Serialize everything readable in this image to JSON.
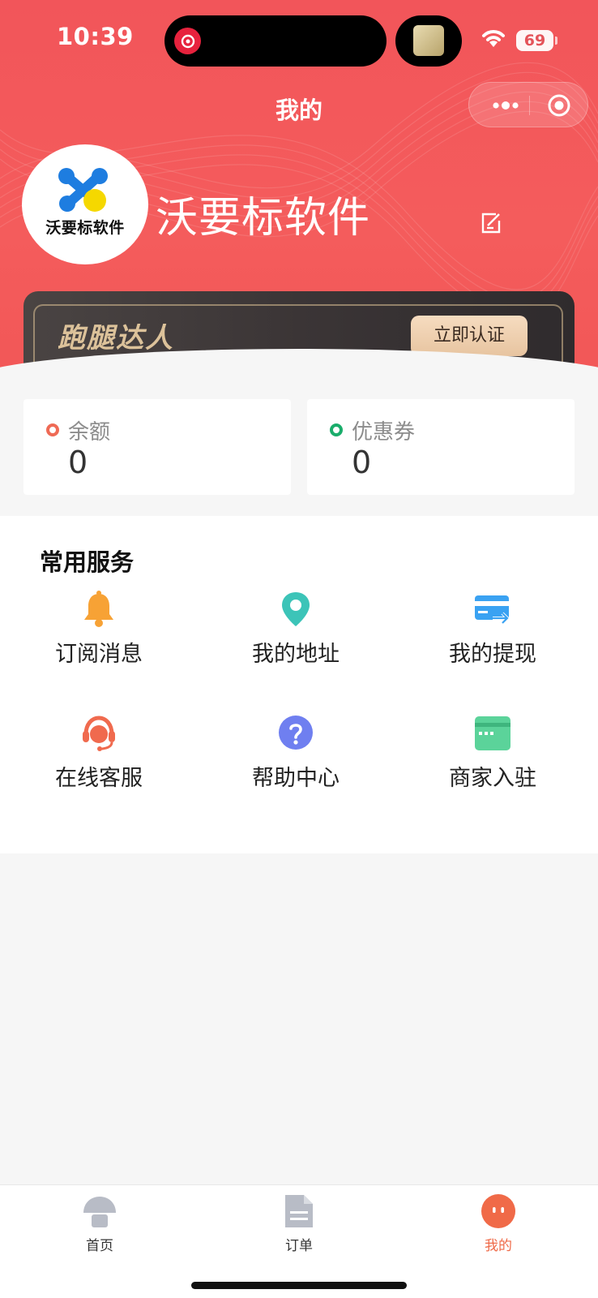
{
  "status_bar": {
    "time": "10:39",
    "battery": "69",
    "battery_level": 0.69
  },
  "header": {
    "title": "我的"
  },
  "profile": {
    "avatar_text": "沃要标软件",
    "name": "沃要标软件"
  },
  "runner_card": {
    "title": "跑腿达人",
    "button": "立即认证"
  },
  "stats": [
    {
      "label": "余额",
      "value": "0"
    },
    {
      "label": "优惠券",
      "value": "0"
    }
  ],
  "services": {
    "title": "常用服务",
    "items": [
      {
        "label": "订阅消息",
        "icon": "bell-icon"
      },
      {
        "label": "我的地址",
        "icon": "location-pin-icon"
      },
      {
        "label": "我的提现",
        "icon": "card-transfer-icon"
      },
      {
        "label": "在线客服",
        "icon": "headset-icon"
      },
      {
        "label": "帮助中心",
        "icon": "help-question-icon"
      },
      {
        "label": "商家入驻",
        "icon": "merchant-card-icon"
      }
    ]
  },
  "tabbar": {
    "items": [
      {
        "label": "首页",
        "icon": "home-icon"
      },
      {
        "label": "订单",
        "icon": "order-document-icon"
      },
      {
        "label": "我的",
        "icon": "profile-face-icon"
      }
    ],
    "active_index": 2
  },
  "colors": {
    "header_red": "#f45c5c",
    "accent": "#ef6a48",
    "balance_dot": "#ef6a55",
    "coupon_dot": "#1aad6b"
  }
}
